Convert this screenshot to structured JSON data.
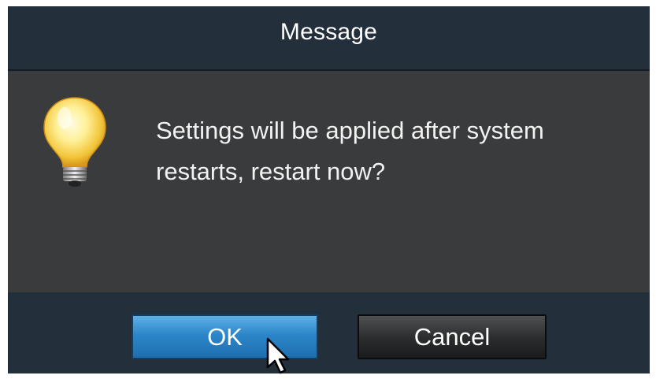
{
  "dialog": {
    "title": "Message",
    "message_line1": "Settings will be applied after system",
    "message_line2": "restarts, restart now?",
    "icon": "lightbulb-icon"
  },
  "buttons": {
    "ok_label": "OK",
    "cancel_label": "Cancel"
  },
  "colors": {
    "title_bar": "#232f3a",
    "body": "#3a3b3c",
    "ok_button": "#2b86c9",
    "cancel_button": "#2a2b2c",
    "text": "#ffffff"
  },
  "pointer": "mouse-pointer-icon"
}
